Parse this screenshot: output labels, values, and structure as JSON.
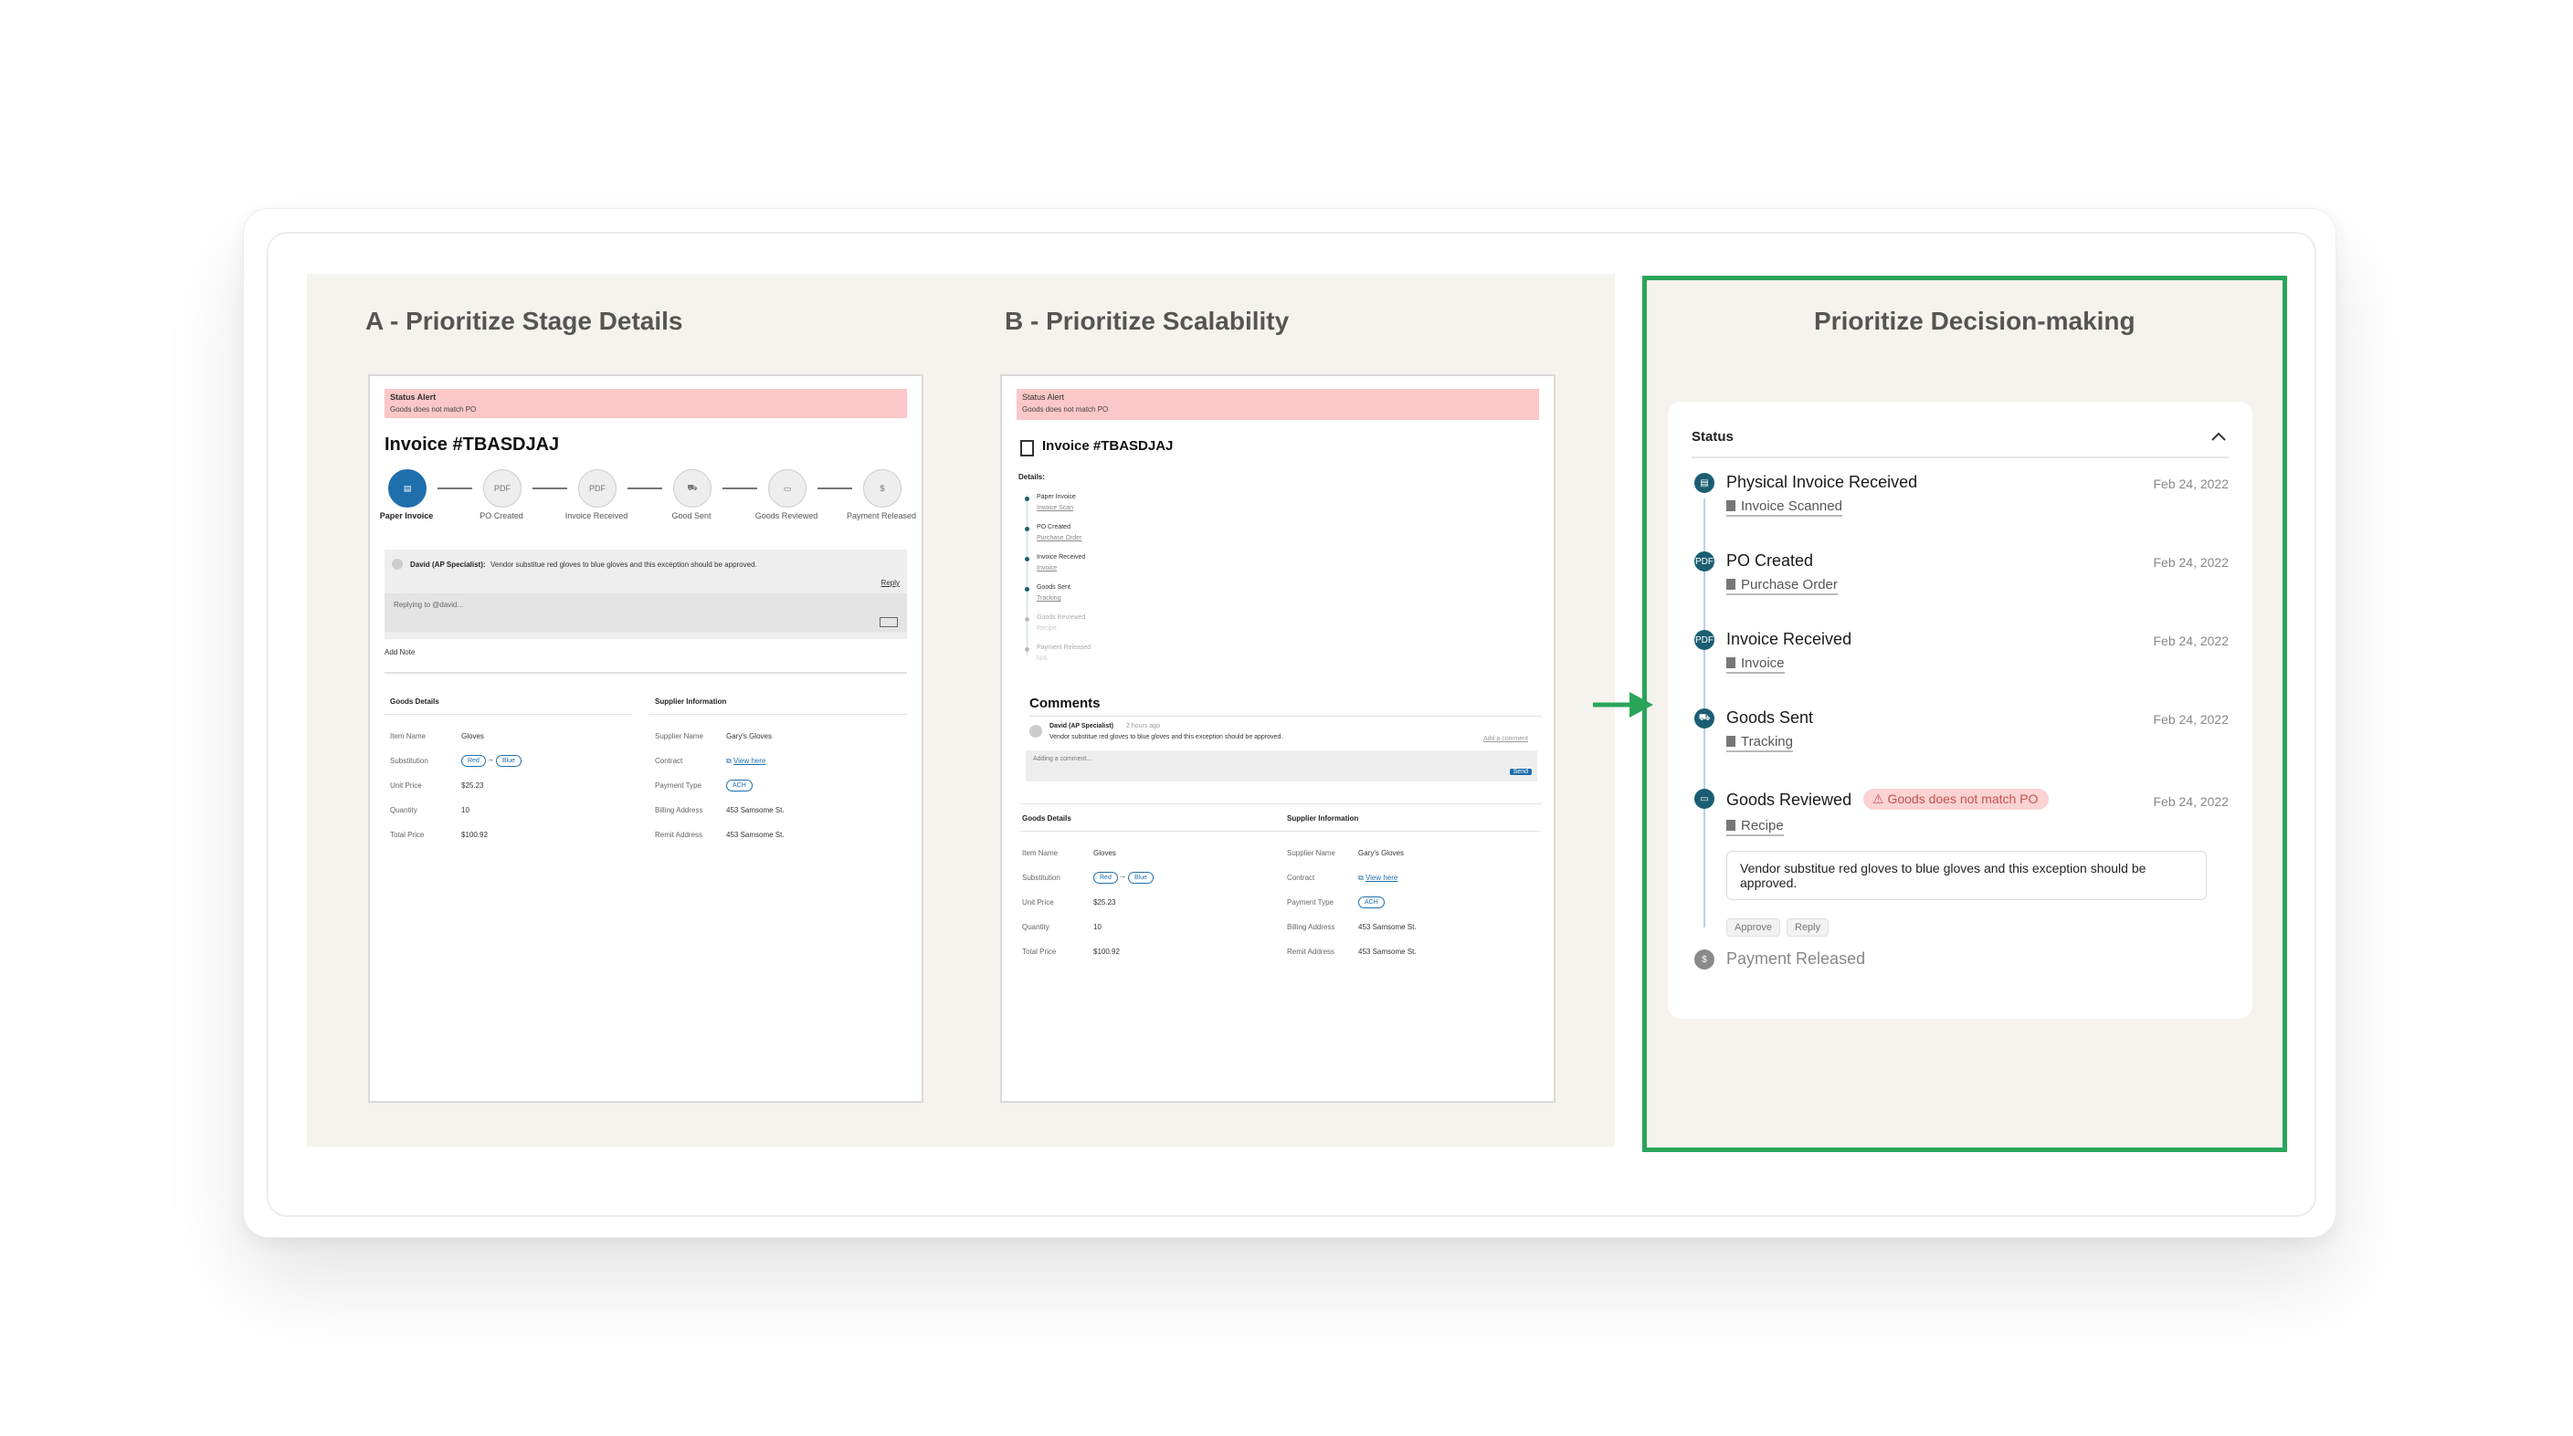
{
  "columns": {
    "a_title": "A - Prioritize Stage Details",
    "b_title": "B - Prioritize Scalability",
    "c_title": "Prioritize Decision-making"
  },
  "alert": {
    "title": "Status Alert",
    "subtitle": "Goods does not match PO"
  },
  "invoice_title": "Invoice #TBASDJAJ",
  "steps": [
    {
      "label": "Paper Invoice",
      "icon": "document-icon"
    },
    {
      "label": "PO Created",
      "icon": "pdf-icon"
    },
    {
      "label": "Invoice Received",
      "icon": "pdf-icon"
    },
    {
      "label": "Good Sent",
      "icon": "truck-icon"
    },
    {
      "label": "Goods Reviewed",
      "icon": "review-icon"
    },
    {
      "label": "Payment Released",
      "icon": "dollar-icon"
    }
  ],
  "comment": {
    "author": "David (AP Specialist):",
    "author_b": "David (AP Specialist)",
    "time_b": "2 hours ago",
    "text": "Vendor substitue red gloves to blue gloves and this exception should be approved.",
    "reply": "Reply",
    "reply_placeholder": "Replying to @david...",
    "add_note": "Add Note",
    "add_comment": "Add a comment",
    "adding_placeholder": "Adding a comment...",
    "send": "Send",
    "comments_heading": "Comments"
  },
  "goods_details": {
    "heading": "Goods Details",
    "rows": [
      {
        "label": "Item Name",
        "value": "Gloves"
      },
      {
        "label": "Substitution",
        "value": ""
      },
      {
        "label": "Unit Price",
        "value": "$25.23"
      },
      {
        "label": "Quantity",
        "value": "10"
      },
      {
        "label": "Total Price",
        "value": "$100.92"
      }
    ],
    "sub_from": "Red",
    "sub_to": "Blue"
  },
  "supplier": {
    "heading": "Supplier Information",
    "rows": [
      {
        "label": "Supplier Name",
        "value": "Gary's Gloves"
      },
      {
        "label": "Contract",
        "value": "View here"
      },
      {
        "label": "Payment Type",
        "value": "ACH"
      },
      {
        "label": "Billing Address",
        "value": "453 Samsome St."
      },
      {
        "label": "Remit Address",
        "value": "453 Samsome St."
      }
    ]
  },
  "b_details": {
    "heading": "Details:",
    "items": [
      {
        "title": "Paper Invoice",
        "link": "Invoice Scan"
      },
      {
        "title": "PO Created",
        "link": "Purchase Order"
      },
      {
        "title": "Invoice Received",
        "link": "Invoice"
      },
      {
        "title": "Goods Sent",
        "link": "Tracking"
      },
      {
        "title": "Goods Reviewed",
        "link": "Recipe"
      },
      {
        "title": "Payment Released",
        "link": "N/A"
      }
    ]
  },
  "status_panel": {
    "heading": "Status",
    "items": [
      {
        "title": "Physical Invoice Received",
        "link": "Invoice Scanned",
        "date": "Feb 24, 2022",
        "icon": "document-icon"
      },
      {
        "title": "PO Created",
        "link": "Purchase Order",
        "date": "Feb 24, 2022",
        "icon": "pdf-icon"
      },
      {
        "title": "Invoice Received",
        "link": "Invoice",
        "date": "Feb 24, 2022",
        "icon": "pdf-icon"
      },
      {
        "title": "Goods Sent",
        "link": "Tracking",
        "date": "Feb 24, 2022",
        "icon": "truck-icon"
      },
      {
        "title": "Goods Reviewed",
        "link": "Recipe",
        "date": "Feb 24, 2022",
        "icon": "review-icon"
      }
    ],
    "warning": "Goods does not match PO",
    "note": "Vendor substitue red gloves to blue gloves and this exception should be approved.",
    "approve": "Approve",
    "reply": "Reply",
    "last": "Payment Released"
  },
  "colors": {
    "accent": "#1f6fad",
    "teal": "#1b5e73",
    "green_frame": "#2aa55a",
    "alert_bg": "#fbc7c7"
  }
}
